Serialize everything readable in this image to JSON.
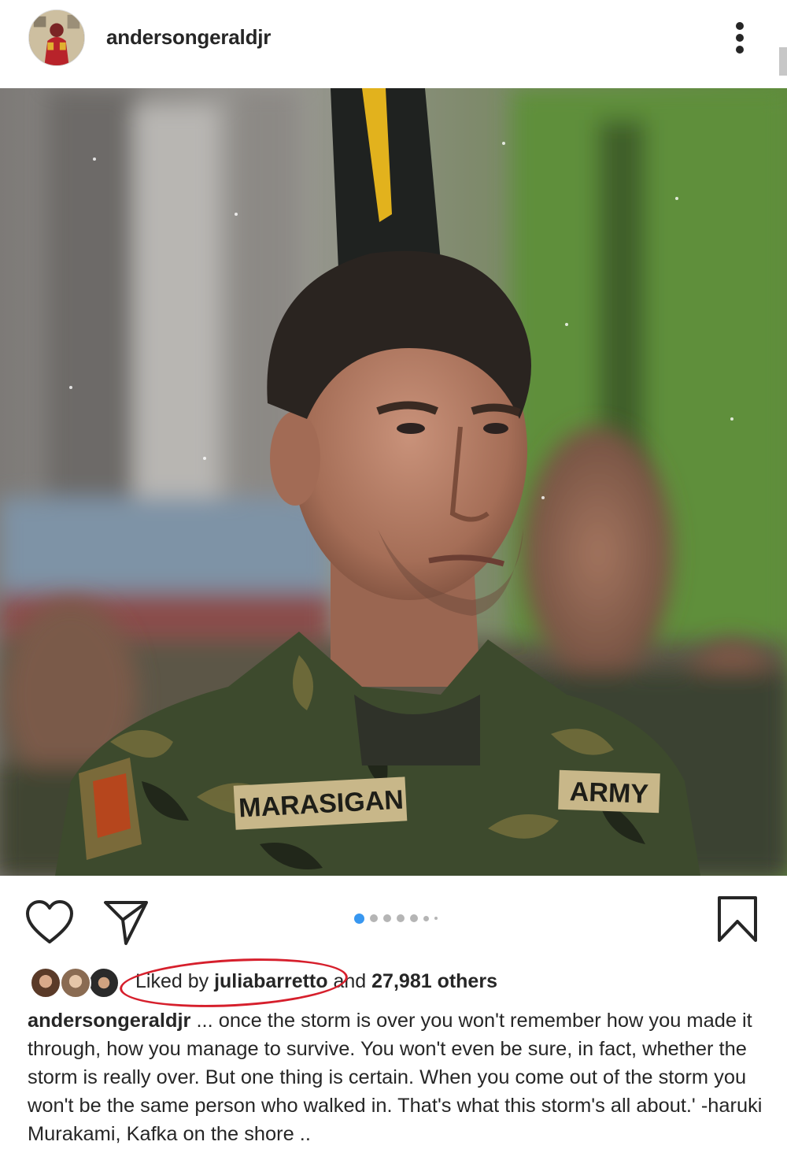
{
  "header": {
    "username": "andersongeraldjr",
    "avatar_icon": "profile-avatar",
    "more_icon": "more-vertical-icon"
  },
  "post": {
    "image_description_label": "",
    "patch_name": "MARASIGAN",
    "patch_branch": "ARMY"
  },
  "actions": {
    "like_icon": "heart-icon",
    "share_icon": "send-icon",
    "save_icon": "bookmark-icon",
    "carousel": {
      "count": 7,
      "active_index": 0
    }
  },
  "likes": {
    "prefix": "Liked by ",
    "user": "juliabarretto",
    "and": " and ",
    "count": "27,981 others"
  },
  "caption": {
    "user": "andersongeraldjr",
    "text": " ... once the storm is over you won't remember how you made it through, how you manage to survive. You won't even be sure, in fact, whether the storm is really over. But one thing is certain. When you come out of the storm you won't be the same person who walked in. That's what this storm's all about.' -haruki Murakami, Kafka on the shore .."
  },
  "colors": {
    "text": "#262626",
    "accent_blue": "#3897f0",
    "highlight_red": "#d61f2c"
  }
}
